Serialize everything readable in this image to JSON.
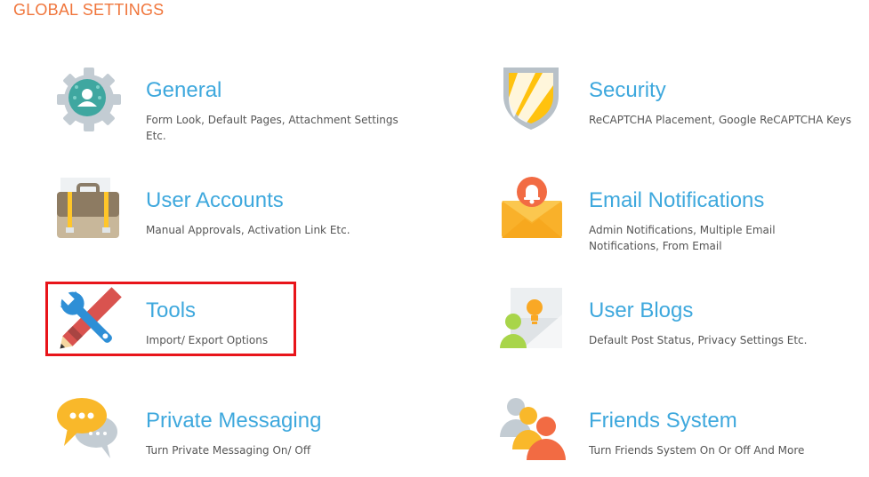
{
  "page": {
    "title": "GLOBAL SETTINGS"
  },
  "colors": {
    "title_orange": "#f0763c",
    "tile_title_blue": "#3ea8dd",
    "highlight_red": "#e8141a"
  },
  "tiles": {
    "general": {
      "title": "General",
      "description": "Form Look, Default Pages, Attachment Settings Etc.",
      "icon": "gear-user-icon"
    },
    "security": {
      "title": "Security",
      "description": "ReCAPTCHA Placement, Google ReCAPTCHA Keys",
      "icon": "shield-icon"
    },
    "user_accounts": {
      "title": "User Accounts",
      "description": "Manual Approvals, Activation Link Etc.",
      "icon": "briefcase-icon"
    },
    "email_notifications": {
      "title": "Email Notifications",
      "description": "Admin Notifications, Multiple Email Notifications, From Email",
      "icon": "envelope-bell-icon"
    },
    "tools": {
      "title": "Tools",
      "description": "Import/ Export Options",
      "icon": "wrench-pencil-icon"
    },
    "user_blogs": {
      "title": "User Blogs",
      "description": "Default Post Status, Privacy Settings Etc.",
      "icon": "blog-user-icon"
    },
    "private_messaging": {
      "title": "Private Messaging",
      "description": "Turn Private Messaging On/ Off",
      "icon": "chat-bubbles-icon"
    },
    "friends_system": {
      "title": "Friends System",
      "description": "Turn Friends System On Or Off And More",
      "icon": "friends-group-icon"
    }
  }
}
